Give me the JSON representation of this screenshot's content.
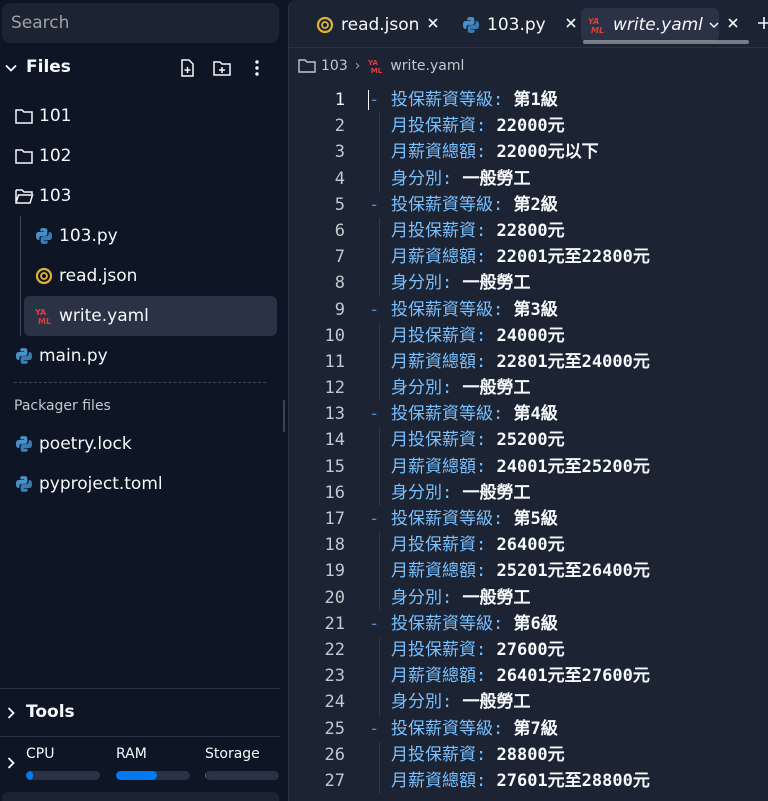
{
  "search": {
    "placeholder": "Search"
  },
  "files": {
    "title": "Files",
    "items": [
      {
        "label": "101",
        "icon": "folder-icon"
      },
      {
        "label": "102",
        "icon": "folder-icon"
      },
      {
        "label": "103",
        "icon": "folder-open-icon"
      },
      {
        "label": "103.py",
        "icon": "python-icon"
      },
      {
        "label": "read.json",
        "icon": "json-icon"
      },
      {
        "label": "write.yaml",
        "icon": "yaml-icon"
      },
      {
        "label": "main.py",
        "icon": "python-icon"
      }
    ]
  },
  "packager": {
    "title": "Packager files",
    "items": [
      {
        "label": "poetry.lock",
        "icon": "python-icon"
      },
      {
        "label": "pyproject.toml",
        "icon": "python-icon"
      }
    ]
  },
  "tools": {
    "title": "Tools"
  },
  "resources": {
    "cpu": {
      "label": "CPU",
      "fill": 0.1
    },
    "ram": {
      "label": "RAM",
      "fill": 0.55
    },
    "storage": {
      "label": "Storage",
      "fill": 0.02
    }
  },
  "tabs": [
    {
      "label": "read.json",
      "icon": "json-icon"
    },
    {
      "label": "103.py",
      "icon": "python-icon"
    },
    {
      "label": "write.yaml",
      "icon": "yaml-icon",
      "active": true
    }
  ],
  "breadcrumb": {
    "folder": "103",
    "file": "write.yaml"
  },
  "code_lines": [
    {
      "n": "1",
      "k": "投保薪資等級:",
      "v": " 第1級",
      "dash": true
    },
    {
      "n": "2",
      "k": "月投保薪資:",
      "v": " 22000元"
    },
    {
      "n": "3",
      "k": "月薪資總額:",
      "v": " 22000元以下"
    },
    {
      "n": "4",
      "k": "身分別:",
      "v": " 一般勞工"
    },
    {
      "n": "5",
      "k": "投保薪資等級:",
      "v": " 第2級",
      "dash": true
    },
    {
      "n": "6",
      "k": "月投保薪資:",
      "v": " 22800元"
    },
    {
      "n": "7",
      "k": "月薪資總額:",
      "v": " 22001元至22800元"
    },
    {
      "n": "8",
      "k": "身分別:",
      "v": " 一般勞工"
    },
    {
      "n": "9",
      "k": "投保薪資等級:",
      "v": " 第3級",
      "dash": true
    },
    {
      "n": "10",
      "k": "月投保薪資:",
      "v": " 24000元"
    },
    {
      "n": "11",
      "k": "月薪資總額:",
      "v": " 22801元至24000元"
    },
    {
      "n": "12",
      "k": "身分別:",
      "v": " 一般勞工"
    },
    {
      "n": "13",
      "k": "投保薪資等級:",
      "v": " 第4級",
      "dash": true
    },
    {
      "n": "14",
      "k": "月投保薪資:",
      "v": " 25200元"
    },
    {
      "n": "15",
      "k": "月薪資總額:",
      "v": " 24001元至25200元"
    },
    {
      "n": "16",
      "k": "身分別:",
      "v": " 一般勞工"
    },
    {
      "n": "17",
      "k": "投保薪資等級:",
      "v": " 第5級",
      "dash": true
    },
    {
      "n": "18",
      "k": "月投保薪資:",
      "v": " 26400元"
    },
    {
      "n": "19",
      "k": "月薪資總額:",
      "v": " 25201元至26400元"
    },
    {
      "n": "20",
      "k": "身分別:",
      "v": " 一般勞工"
    },
    {
      "n": "21",
      "k": "投保薪資等級:",
      "v": " 第6級",
      "dash": true
    },
    {
      "n": "22",
      "k": "月投保薪資:",
      "v": " 27600元"
    },
    {
      "n": "23",
      "k": "月薪資總額:",
      "v": " 26401元至27600元"
    },
    {
      "n": "24",
      "k": "身分別:",
      "v": " 一般勞工"
    },
    {
      "n": "25",
      "k": "投保薪資等級:",
      "v": " 第7級",
      "dash": true
    },
    {
      "n": "26",
      "k": "月投保薪資:",
      "v": " 28800元"
    },
    {
      "n": "27",
      "k": "月薪資總額:",
      "v": " 27601元至28800元"
    }
  ]
}
